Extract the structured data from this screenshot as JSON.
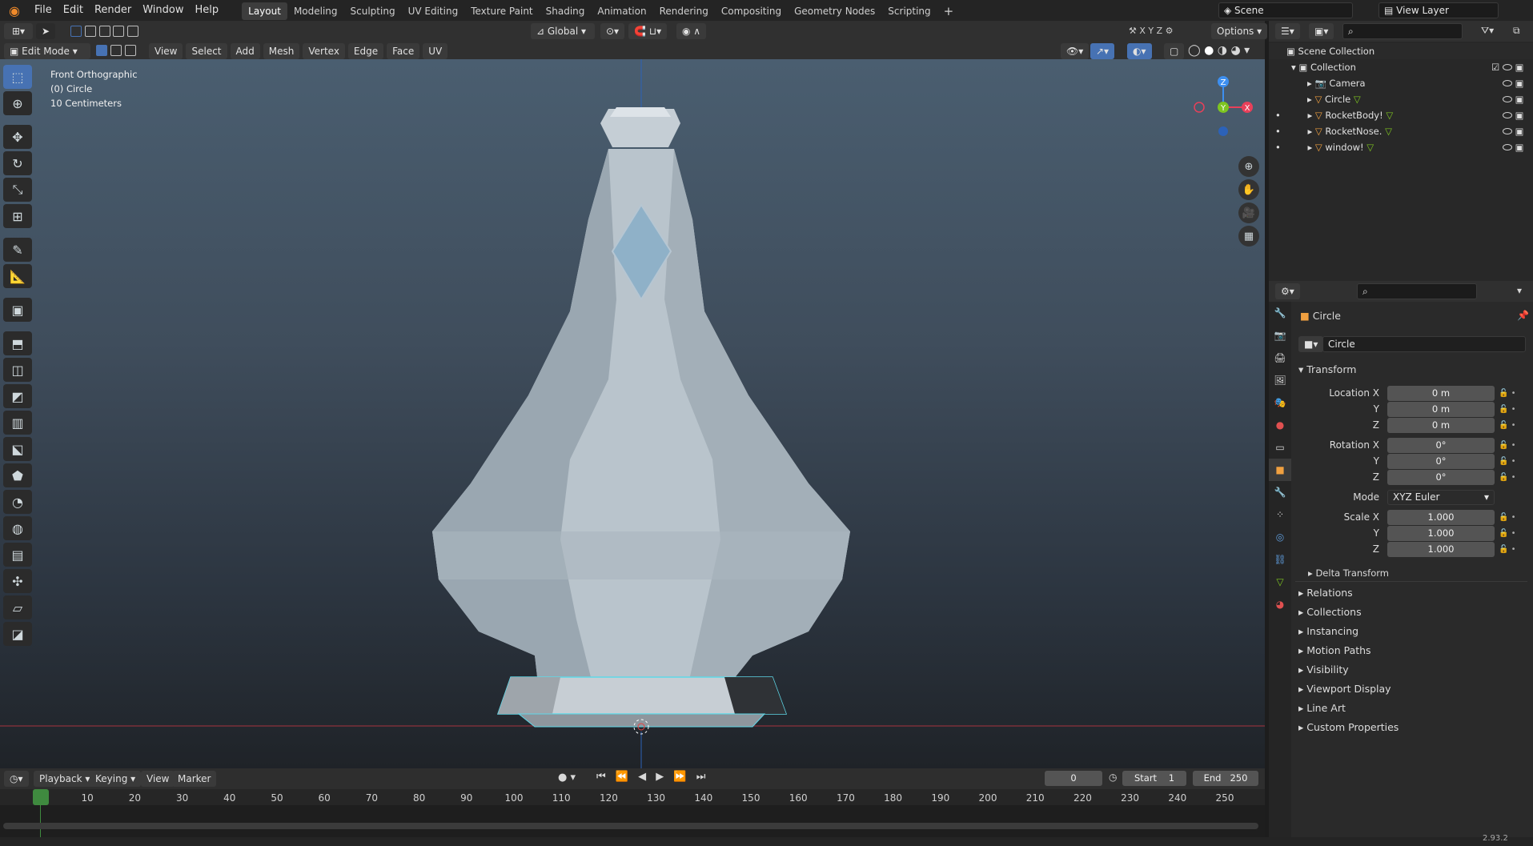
{
  "topbar": {
    "menus": [
      "File",
      "Edit",
      "Render",
      "Window",
      "Help"
    ],
    "workspaces": [
      "Layout",
      "Modeling",
      "Sculpting",
      "UV Editing",
      "Texture Paint",
      "Shading",
      "Animation",
      "Rendering",
      "Compositing",
      "Geometry Nodes",
      "Scripting"
    ],
    "active_workspace": "Layout",
    "scene": "Scene",
    "view_layer": "View Layer"
  },
  "viewport_header": {
    "mode": "Edit Mode",
    "menus": [
      "View",
      "Select",
      "Add",
      "Mesh",
      "Vertex",
      "Edge",
      "Face",
      "UV"
    ],
    "orientation": "Global",
    "options": "Options",
    "axes": [
      "X",
      "Y",
      "Z"
    ]
  },
  "viewport": {
    "view_name": "Front Orthographic",
    "object_info": "(0) Circle",
    "scale_info": "10 Centimeters",
    "gizmo": {
      "z": "Z",
      "y": "Y",
      "x": "X"
    }
  },
  "outliner": {
    "root": "Scene Collection",
    "collection": "Collection",
    "items": [
      {
        "name": "Camera",
        "type": "camera"
      },
      {
        "name": "Circle",
        "type": "mesh"
      },
      {
        "name": "RocketBody!",
        "type": "mesh"
      },
      {
        "name": "RocketNose.",
        "type": "mesh"
      },
      {
        "name": "window!",
        "type": "mesh"
      }
    ]
  },
  "properties": {
    "object_name": "Circle",
    "data_name": "Circle",
    "transform_title": "Transform",
    "location": {
      "label": "Location X",
      "x": "0 m",
      "y": "0 m",
      "z": "0 m"
    },
    "rotation": {
      "label": "Rotation X",
      "x": "0°",
      "y": "0°",
      "z": "0°"
    },
    "mode_label": "Mode",
    "mode_value": "XYZ Euler",
    "scale": {
      "label": "Scale X",
      "x": "1.000",
      "y": "1.000",
      "z": "1.000"
    },
    "axis_labels": {
      "y": "Y",
      "z": "Z"
    },
    "delta": "Delta Transform",
    "panels": [
      "Relations",
      "Collections",
      "Instancing",
      "Motion Paths",
      "Visibility",
      "Viewport Display",
      "Line Art",
      "Custom Properties"
    ]
  },
  "timeline": {
    "menus": [
      "Playback",
      "Keying",
      "View",
      "Marker"
    ],
    "current_frame": "0",
    "start_label": "Start",
    "start": "1",
    "end_label": "End",
    "end": "250",
    "ticks": [
      "0",
      "10",
      "20",
      "30",
      "40",
      "50",
      "60",
      "70",
      "80",
      "90",
      "100",
      "110",
      "120",
      "130",
      "140",
      "150",
      "160",
      "170",
      "180",
      "190",
      "200",
      "210",
      "220",
      "230",
      "240",
      "250"
    ]
  },
  "status": {
    "version": "2.93.2"
  },
  "colors": {
    "accent": "#4772b3",
    "selection": "#5fd8e8",
    "x_axis": "#e8405a",
    "y_axis": "#7ec521",
    "z_axis": "#3d8ff0"
  }
}
